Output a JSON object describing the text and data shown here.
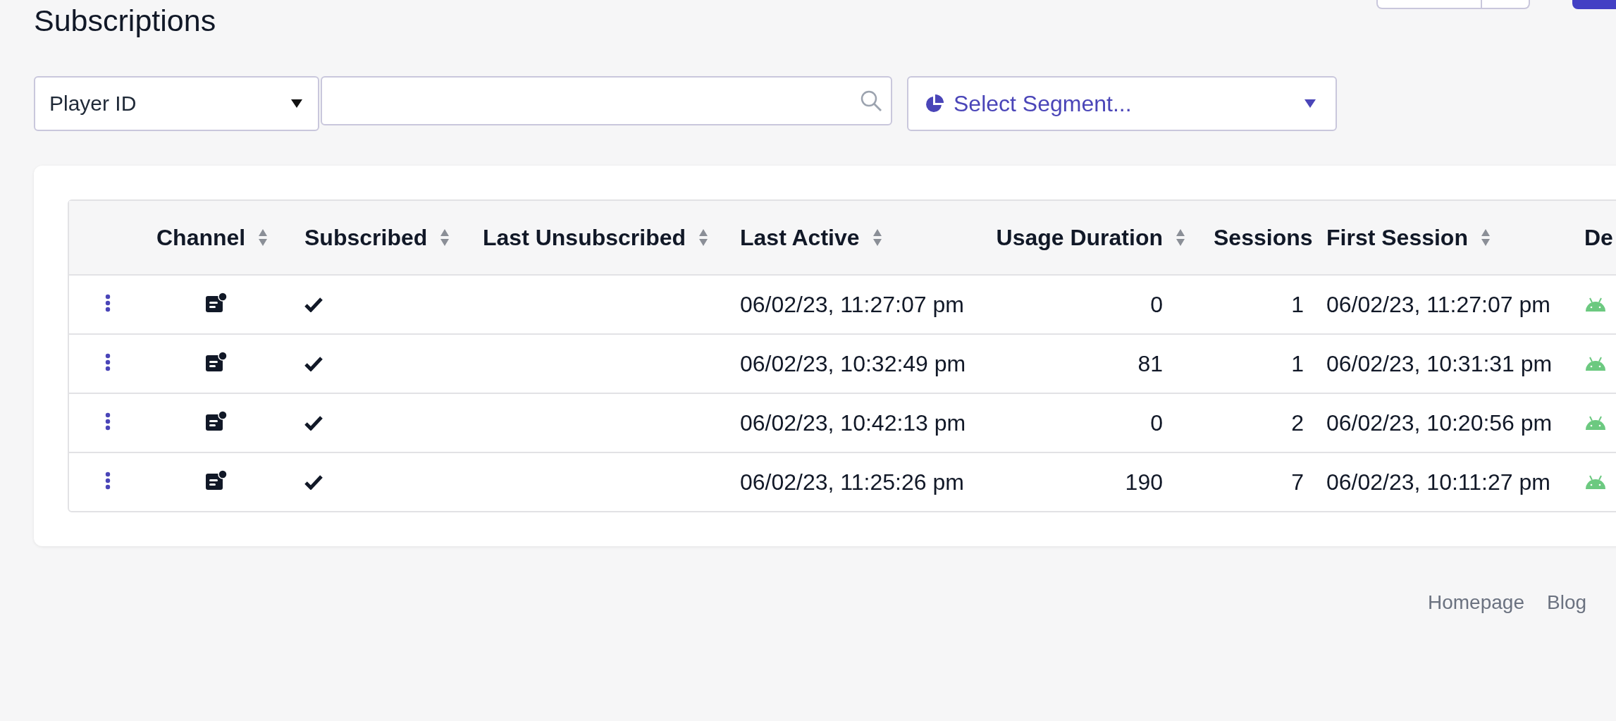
{
  "page": {
    "title": "Subscriptions"
  },
  "filters": {
    "field_select": {
      "value": "Player ID"
    },
    "segment_select": {
      "label": "Select Segment..."
    }
  },
  "table": {
    "columns": [
      {
        "label": "Channel",
        "sortable": true
      },
      {
        "label": "Subscribed",
        "sortable": true
      },
      {
        "label": "Last Unsubscribed",
        "sortable": true
      },
      {
        "label": "Last Active",
        "sortable": true
      },
      {
        "label": "Usage Duration",
        "sortable": true
      },
      {
        "label": "Sessions",
        "sortable": false
      },
      {
        "label": "First Session",
        "sortable": true
      },
      {
        "label": "De",
        "sortable": false
      }
    ],
    "rows": [
      {
        "subscribed": true,
        "last_active": "06/02/23, 11:27:07 pm",
        "usage_duration": "0",
        "sessions": "1",
        "first_session": "06/02/23, 11:27:07 pm",
        "device_icon": {
          "kind": "android"
        }
      },
      {
        "subscribed": true,
        "last_active": "06/02/23, 10:32:49 pm",
        "usage_duration": "81",
        "sessions": "1",
        "first_session": "06/02/23, 10:31:31 pm",
        "device_icon": {
          "kind": "android"
        }
      },
      {
        "subscribed": true,
        "last_active": "06/02/23, 10:42:13 pm",
        "usage_duration": "0",
        "sessions": "2",
        "first_session": "06/02/23, 10:20:56 pm",
        "device_icon": {
          "kind": "android"
        }
      },
      {
        "subscribed": true,
        "last_active": "06/02/23, 11:25:26 pm",
        "usage_duration": "190",
        "sessions": "7",
        "first_session": "06/02/23, 10:11:27 pm",
        "device_icon": {
          "kind": "android"
        }
      }
    ]
  },
  "footer": {
    "links": [
      "Homepage",
      "Blog"
    ]
  }
}
